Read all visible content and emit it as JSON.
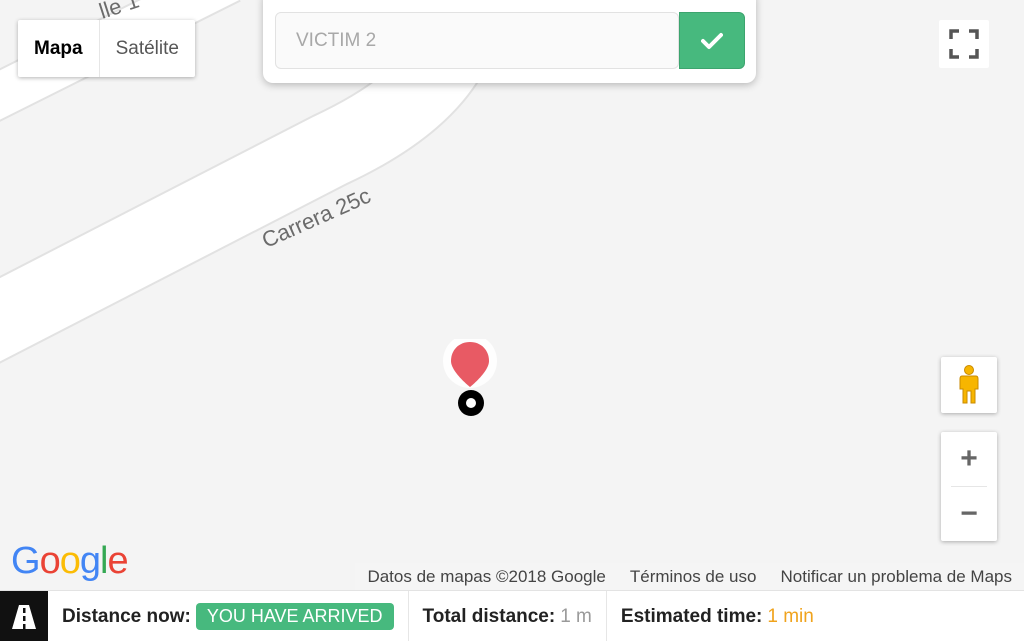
{
  "map": {
    "road_labels": [
      "Carrera 25c",
      "lle 1"
    ],
    "marker_icon": "map-pin-icon",
    "colors": {
      "marker_pin": "#e85a64",
      "road": "#ffffff",
      "road_edge": "#e4e4e4",
      "background": "#f4f4f4"
    }
  },
  "map_type": {
    "options": [
      "Mapa",
      "Satélite"
    ],
    "selected": "Mapa"
  },
  "search": {
    "placeholder": "VICTIM 2",
    "confirm_icon": "check-icon",
    "accent": "#47b97e"
  },
  "controls": {
    "fullscreen_icon": "fullscreen-icon",
    "pegman_icon": "pegman-icon",
    "zoom_in": "+",
    "zoom_out": "−"
  },
  "google_logo": {
    "letters": [
      "G",
      "o",
      "o",
      "g",
      "l",
      "e"
    ],
    "colors": [
      "#4285F4",
      "#EA4335",
      "#FBBC05",
      "#4285F4",
      "#34A853",
      "#EA4335"
    ]
  },
  "attribution": {
    "data": "Datos de mapas ©2018 Google",
    "terms": "Términos de uso",
    "report": "Notificar un problema de Maps"
  },
  "status": {
    "road_icon": "road-icon",
    "distance_now_label": "Distance now:",
    "distance_now_value": "YOU HAVE ARRIVED",
    "total_distance_label": "Total distance:",
    "total_distance_value": "1 m",
    "estimated_time_label": "Estimated time:",
    "estimated_time_value": "1 min"
  }
}
